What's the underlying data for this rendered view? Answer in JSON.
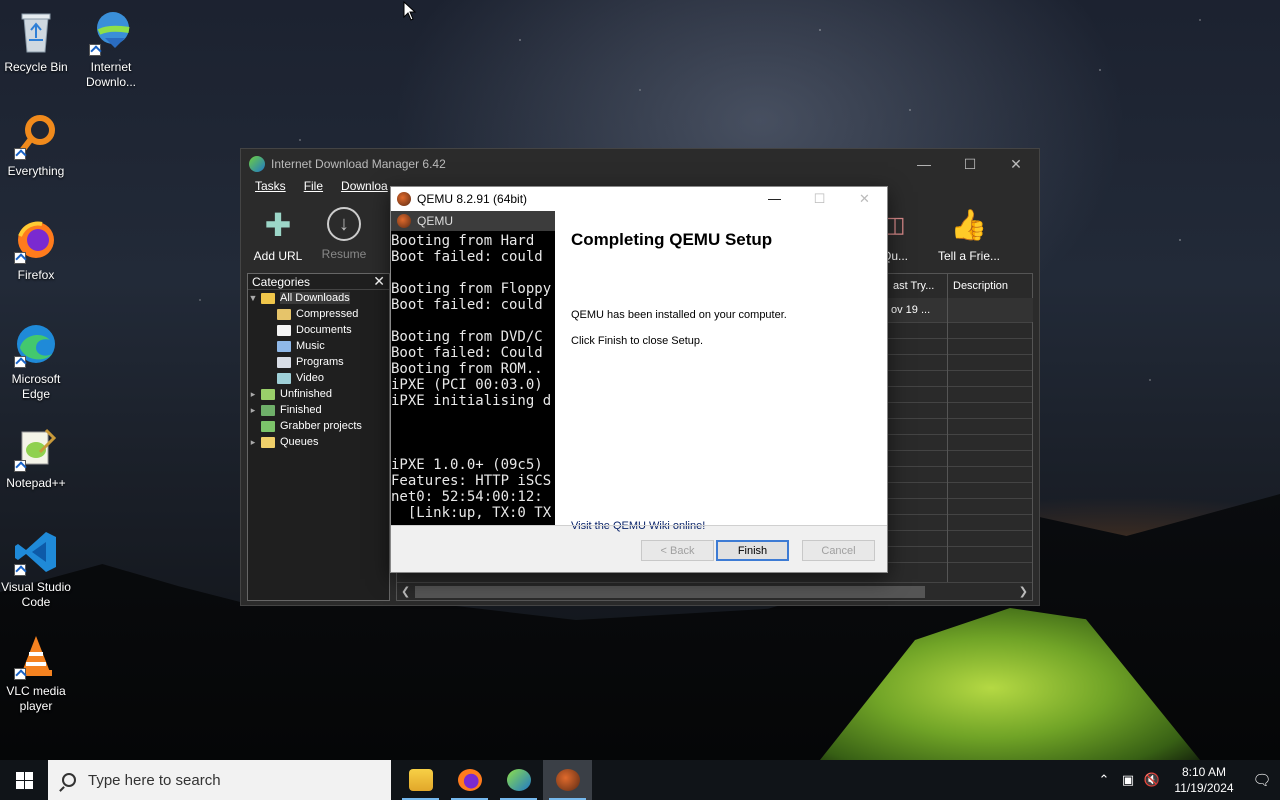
{
  "desktop": {
    "icons": [
      {
        "label": "Recycle Bin",
        "icon": "recycle-bin-icon"
      },
      {
        "label": "Internet Downlo...",
        "icon": "idm-icon"
      },
      {
        "label": "Everything",
        "icon": "everything-search-icon"
      },
      {
        "label": "Firefox",
        "icon": "firefox-icon"
      },
      {
        "label": "Microsoft Edge",
        "icon": "edge-icon"
      },
      {
        "label": "Notepad++",
        "icon": "notepad-plus-icon"
      },
      {
        "label": "Visual Studio Code",
        "icon": "vscode-icon"
      },
      {
        "label": "VLC media player",
        "icon": "vlc-icon"
      }
    ]
  },
  "idm": {
    "title": "Internet Download Manager 6.42",
    "menu": [
      "Tasks",
      "File",
      "Downloa"
    ],
    "toolbar": {
      "add_url": "Add URL",
      "resume": "Resume",
      "queue": "Qu...",
      "tell_friend": "Tell a Frie..."
    },
    "categories": {
      "header": "Categories",
      "items": [
        {
          "label": "All Downloads"
        },
        {
          "label": "Compressed"
        },
        {
          "label": "Documents"
        },
        {
          "label": "Music"
        },
        {
          "label": "Programs"
        },
        {
          "label": "Video"
        },
        {
          "label": "Unfinished"
        },
        {
          "label": "Finished"
        },
        {
          "label": "Grabber projects"
        },
        {
          "label": "Queues"
        }
      ]
    },
    "columns": {
      "last_try": "ast Try...",
      "description": "Description"
    },
    "row": {
      "last_try": "ov 19 ..."
    }
  },
  "qemu": {
    "title": "QEMU 8.2.91 (64bit)",
    "console_tab": "QEMU",
    "console_lines": [
      "Booting from Hard",
      "Boot failed: could",
      "",
      "Booting from Floppy",
      "Boot failed: could",
      "",
      "Booting from DVD/C",
      "Boot failed: Could",
      "Booting from ROM..",
      "iPXE (PCI 00:03.0)",
      "iPXE initialising d",
      "",
      "",
      "",
      "iPXE 1.0.0+ (09c5)",
      "Features: HTTP iSCS",
      "net0: 52:54:00:12:",
      "  [Link:up, TX:0 TX"
    ],
    "heading": "Completing QEMU Setup",
    "text_installed": "QEMU has been installed on your computer.",
    "text_finish": "Click Finish to close Setup.",
    "wiki_link": "Visit the QEMU Wiki online!",
    "buttons": {
      "back": "< Back",
      "finish": "Finish",
      "cancel": "Cancel"
    }
  },
  "taskbar": {
    "search_placeholder": "Type here to search",
    "time": "8:10 AM",
    "date": "11/19/2024",
    "apps": [
      "file-explorer-icon",
      "firefox-icon",
      "idm-icon",
      "qemu-icon"
    ]
  }
}
